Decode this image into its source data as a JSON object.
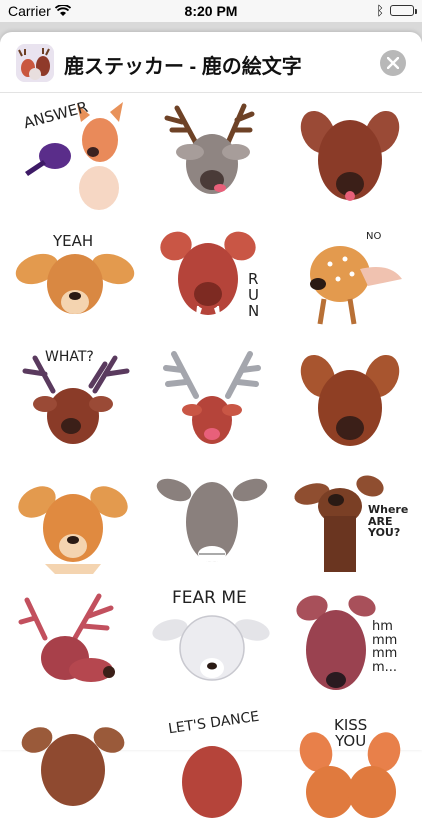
{
  "status_bar": {
    "carrier": "Carrier",
    "time": "8:20 PM"
  },
  "header": {
    "title": "鹿ステッカー - 鹿の絵文字",
    "close_icon": "close-x-icon"
  },
  "stickers": [
    {
      "name": "answer-deer",
      "caption": "ANSWER"
    },
    {
      "name": "stag-tongue",
      "caption": ""
    },
    {
      "name": "brown-doe-face",
      "caption": ""
    },
    {
      "name": "yeah-fawn",
      "caption": "YEAH"
    },
    {
      "name": "run-deer",
      "caption": "RUN"
    },
    {
      "name": "no-fawn",
      "caption": "NO"
    },
    {
      "name": "what-stag",
      "caption": "WHAT?"
    },
    {
      "name": "silver-antler-stag",
      "caption": ""
    },
    {
      "name": "smirk-deer",
      "caption": ""
    },
    {
      "name": "sad-fawn",
      "caption": ""
    },
    {
      "name": "grin-doe",
      "caption": ""
    },
    {
      "name": "where-are-you-deer",
      "caption": "Where\nARE\nYOU?"
    },
    {
      "name": "red-stag",
      "caption": ""
    },
    {
      "name": "fear-me-sheep-deer",
      "caption": "FEAR ME"
    },
    {
      "name": "hmm-deer",
      "caption": "hm\nmm\nmm\nm..."
    },
    {
      "name": "partial-deer",
      "caption": ""
    },
    {
      "name": "lets-dance-deer",
      "caption": "LET'S DANCE"
    },
    {
      "name": "kiss-you-deer",
      "caption": "KISS\nYOU"
    }
  ],
  "colors": {
    "orange_fur": "#e39a4e",
    "red_fur": "#b5443a",
    "brown_fur": "#8a3b28",
    "grey_fur": "#9a8f8c",
    "antler": "#7a4a2e",
    "purple": "#5a2d8a"
  }
}
